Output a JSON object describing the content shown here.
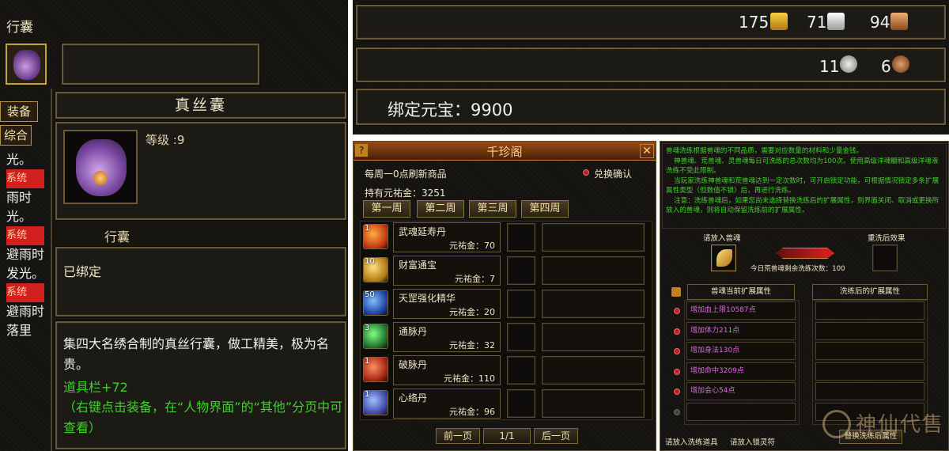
{
  "bag_panel": {
    "title": "行囊",
    "side_tabs": [
      "装备",
      "综合"
    ],
    "side_texts": [
      "光。",
      "系统",
      "雨时",
      "光。",
      "系统",
      "避雨时",
      "发光。",
      "系统",
      "避雨时",
      "落里"
    ]
  },
  "item_tooltip": {
    "name": "真丝囊",
    "level_label": "等级 :9",
    "sub_name": "行囊",
    "bind_status": "已绑定",
    "description": "集四大名绣合制的真丝行囊，做工精美，极为名贵。",
    "stat": "道具栏+72",
    "hint": "（右键点击装备，在“人物界面”的“其他”分页中可查看）"
  },
  "currency": {
    "gold": "175",
    "silver": "71",
    "copper": "94",
    "coin_a": "11",
    "coin_b": "6",
    "bound_yuanbao_label": "绑定元宝：9900"
  },
  "shop": {
    "title": "千珍阁",
    "refresh_text": "每周一0点刷新商品",
    "confirm_label": "兑换确认",
    "balance_label": "持有元祐金：3251",
    "tabs": [
      "第一周",
      "第二周",
      "第三周",
      "第四周"
    ],
    "items": [
      {
        "count": "1",
        "name": "武魂延寿丹",
        "price": "元祐金：70"
      },
      {
        "count": "10",
        "name": "财富通宝",
        "price": "元祐金：7"
      },
      {
        "count": "50",
        "name": "天罡强化精华",
        "price": "元祐金：20"
      },
      {
        "count": "3",
        "name": "通脉丹",
        "price": "元祐金：32"
      },
      {
        "count": "1",
        "name": "破脉丹",
        "price": "元祐金：110"
      },
      {
        "count": "1",
        "name": "心络丹",
        "price": "元祐金：96"
      }
    ],
    "prev_label": "前一页",
    "page_label": "1/1",
    "next_label": "后一页"
  },
  "soul_wash": {
    "intro": [
      "兽魂洗练根据兽魂的不同品质，需要对应数量的材料和少量金钱。",
      "神兽魂、荒兽魂、灵兽魂每日可洗练的总次数均为100次。使用高级洋魂髓和高级洋魂液洗练不受此限制。",
      "当玩家洗练神兽魂和荒兽魂达到一定次数时，可开启锁定功能，可根据情况锁定多条扩展属性类型（但数值不锁）后，再进行洗练。",
      "注意：洗练兽魂后，如果您尚未选择替换洗练后的扩展属性，则界面关闭、取消或更换所放入的兽魂，则将自动保留洗练前的扩展属性。"
    ],
    "put_soul_label": "请放入兽魂",
    "rewash_label": "重洗后效果",
    "remaining_label": "今日荒兽魂剩余洗练次数：100",
    "current_attr_header": "兽魂当前扩展属性",
    "after_attr_header": "洗练后的扩展属性",
    "current_attrs": [
      "增加血上限10587点",
      "增加体力211点",
      "增加身法130点",
      "增加命中3209点",
      "增加会心54点",
      ""
    ],
    "footer_left": "请放入洗练道具",
    "footer_mid": "请放入锁灵符",
    "replace_label": "替换洗练后属性"
  },
  "watermark": "神仙代售",
  "colors": {
    "panel_bg": "#151310",
    "border": "#6b5a3a",
    "green_text": "#3fd12a",
    "purple_text": "#d86be0",
    "shop_title_bg": "#7a3a10"
  }
}
